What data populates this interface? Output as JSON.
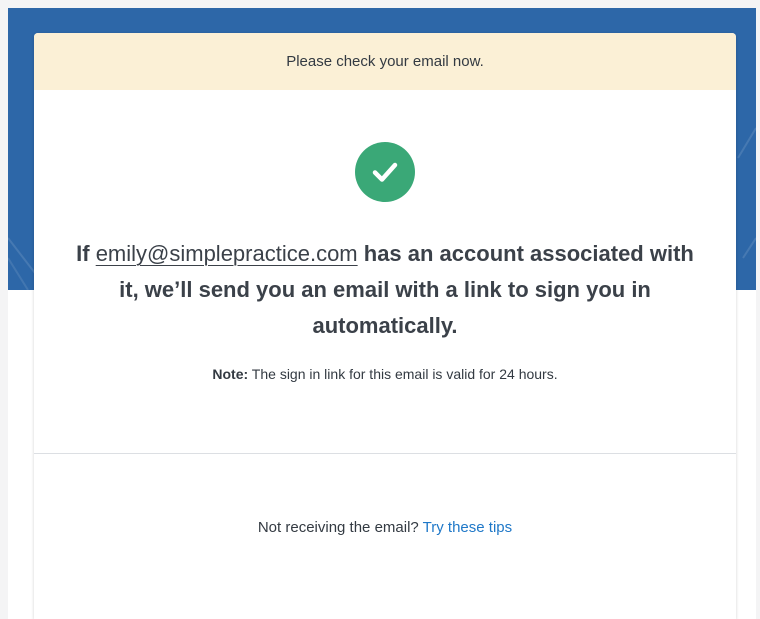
{
  "banner": {
    "text": "Please check your email now."
  },
  "icons": {
    "status": "check-circle-icon"
  },
  "colors": {
    "hero_background": "#2d67a8",
    "banner_background": "#fbf0d6",
    "success_green": "#3aa877",
    "link_blue": "#1f78c8",
    "body_text": "#3b4149"
  },
  "message": {
    "prefix": "If ",
    "email": "emily@simplepractice.com",
    "suffix": " has an account associated with it, we’ll send you an email with a link to sign you in automatically."
  },
  "note": {
    "label": "Note:",
    "text": " The sign in link for this email is valid for 24 hours."
  },
  "help": {
    "question": "Not receiving the email? ",
    "link_label": "Try these tips"
  }
}
